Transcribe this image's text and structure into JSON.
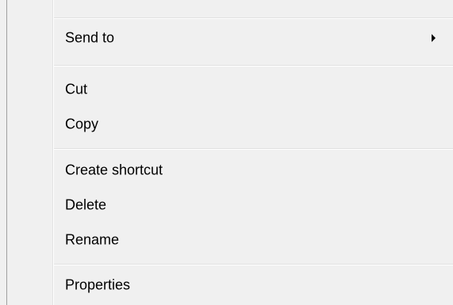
{
  "context_menu": {
    "items": [
      {
        "label": "Send to",
        "has_submenu": true
      },
      {
        "label": "Cut"
      },
      {
        "label": "Copy"
      },
      {
        "label": "Create shortcut"
      },
      {
        "label": "Delete"
      },
      {
        "label": "Rename"
      },
      {
        "label": "Properties"
      }
    ],
    "submenu_icon": "chevron-right-icon"
  }
}
